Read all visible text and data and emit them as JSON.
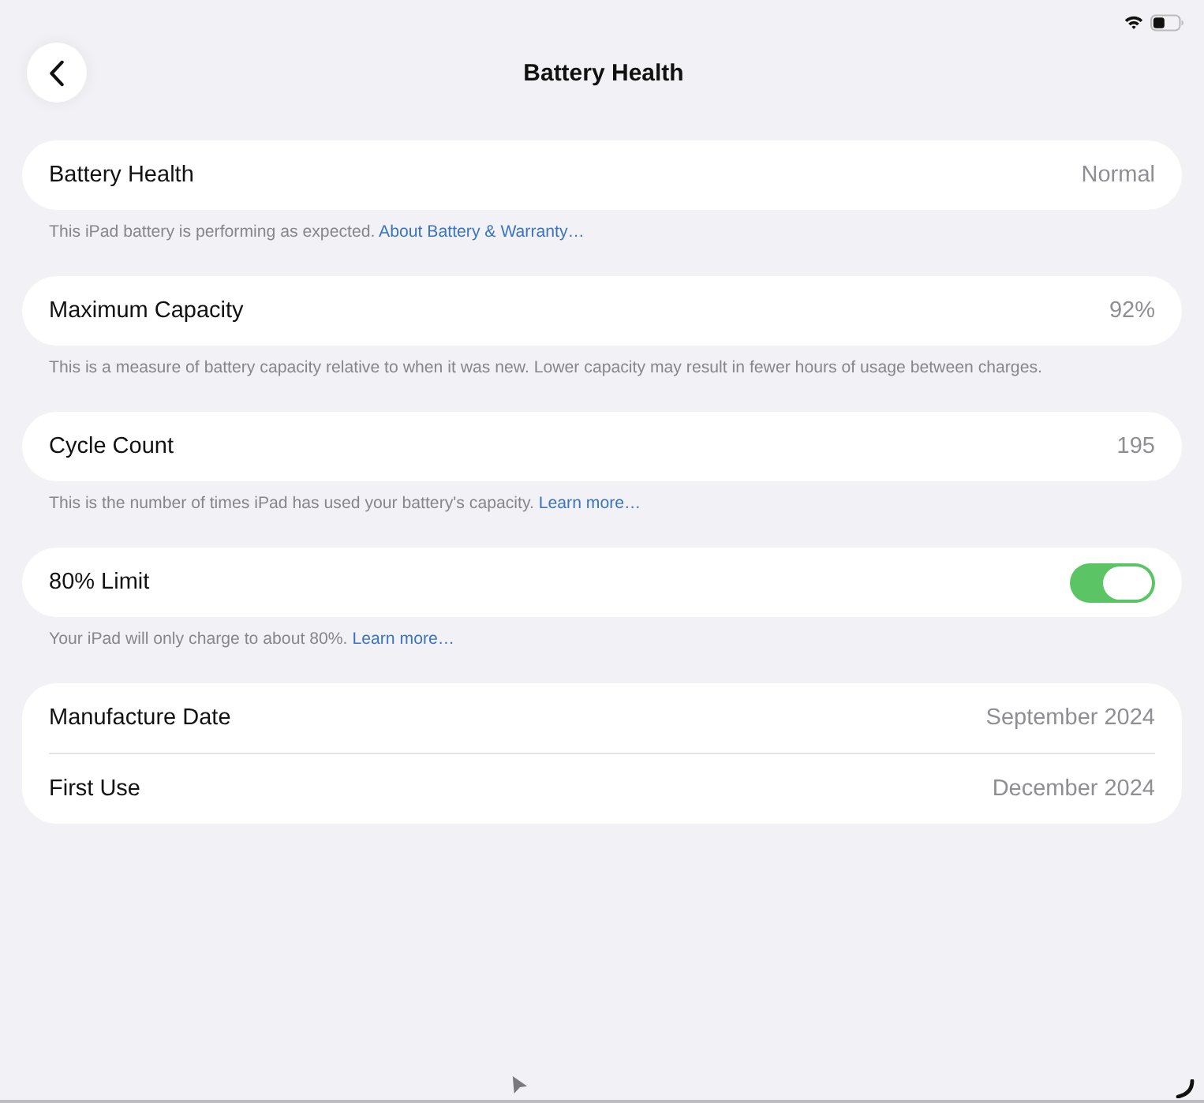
{
  "nav": {
    "title": "Battery Health"
  },
  "sections": [
    {
      "rows": [
        {
          "kind": "value",
          "label": "Battery Health",
          "value": "Normal"
        }
      ],
      "footer": {
        "text": "This iPad battery is performing as expected.",
        "link": "About Battery & Warranty…"
      }
    },
    {
      "rows": [
        {
          "kind": "value",
          "label": "Maximum Capacity",
          "value": "92%"
        }
      ],
      "footer": {
        "text": "This is a measure of battery capacity relative to when it was new. Lower capacity may result in fewer hours of usage between charges."
      }
    },
    {
      "rows": [
        {
          "kind": "value",
          "label": "Cycle Count",
          "value": "195"
        }
      ],
      "footer": {
        "text": "This is the number of times iPad has used your battery's capacity.",
        "link": "Learn more…"
      }
    },
    {
      "rows": [
        {
          "kind": "toggle",
          "label": "80% Limit",
          "on": true
        }
      ],
      "footer": {
        "text": "Your iPad will only charge to about 80%.",
        "link": "Learn more…"
      }
    },
    {
      "rows": [
        {
          "kind": "value",
          "label": "Manufacture Date",
          "value": "September 2024"
        },
        {
          "kind": "value",
          "label": "First Use",
          "value": "December 2024"
        }
      ]
    }
  ]
}
